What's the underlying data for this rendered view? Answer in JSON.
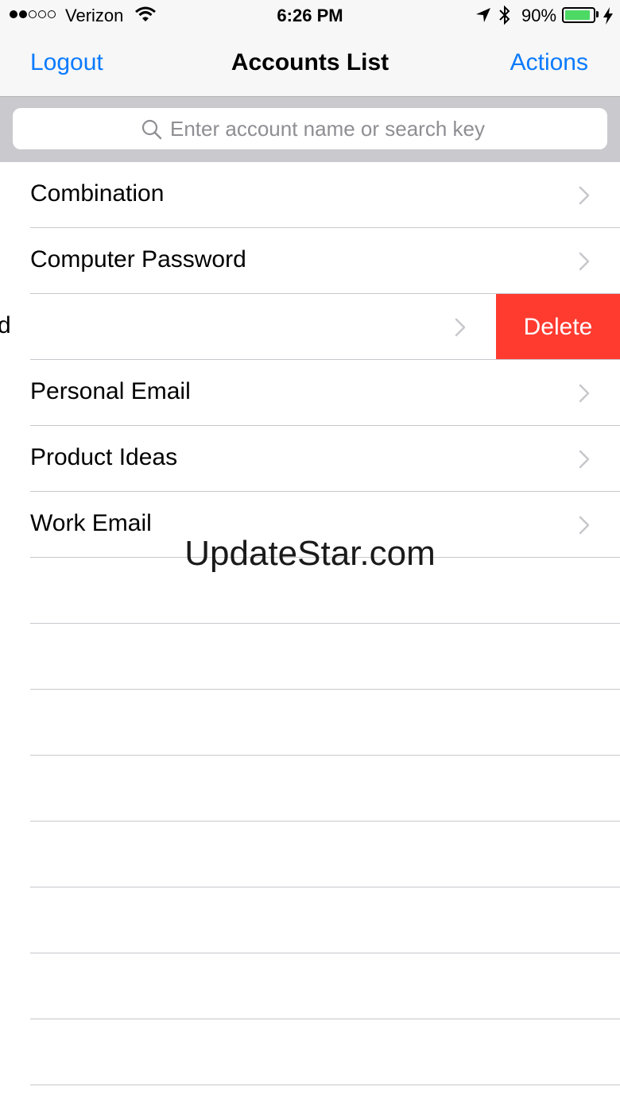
{
  "status_bar": {
    "carrier": "Verizon",
    "time": "6:26 PM",
    "battery_percent": "90%",
    "battery_level": 0.9
  },
  "nav": {
    "left_button": "Logout",
    "title": "Accounts List",
    "right_button": "Actions"
  },
  "search": {
    "placeholder": "Enter account name or search key"
  },
  "accounts": [
    {
      "label": "Combination"
    },
    {
      "label": "Computer Password"
    },
    {
      "label": "Password",
      "swiped": true,
      "action": "Delete"
    },
    {
      "label": "Personal Email"
    },
    {
      "label": "Product Ideas"
    },
    {
      "label": "Work Email"
    }
  ],
  "watermark": "UpdateStar.com",
  "colors": {
    "tint": "#0a7aff",
    "delete": "#ff3b30",
    "battery": "#4cd964"
  }
}
